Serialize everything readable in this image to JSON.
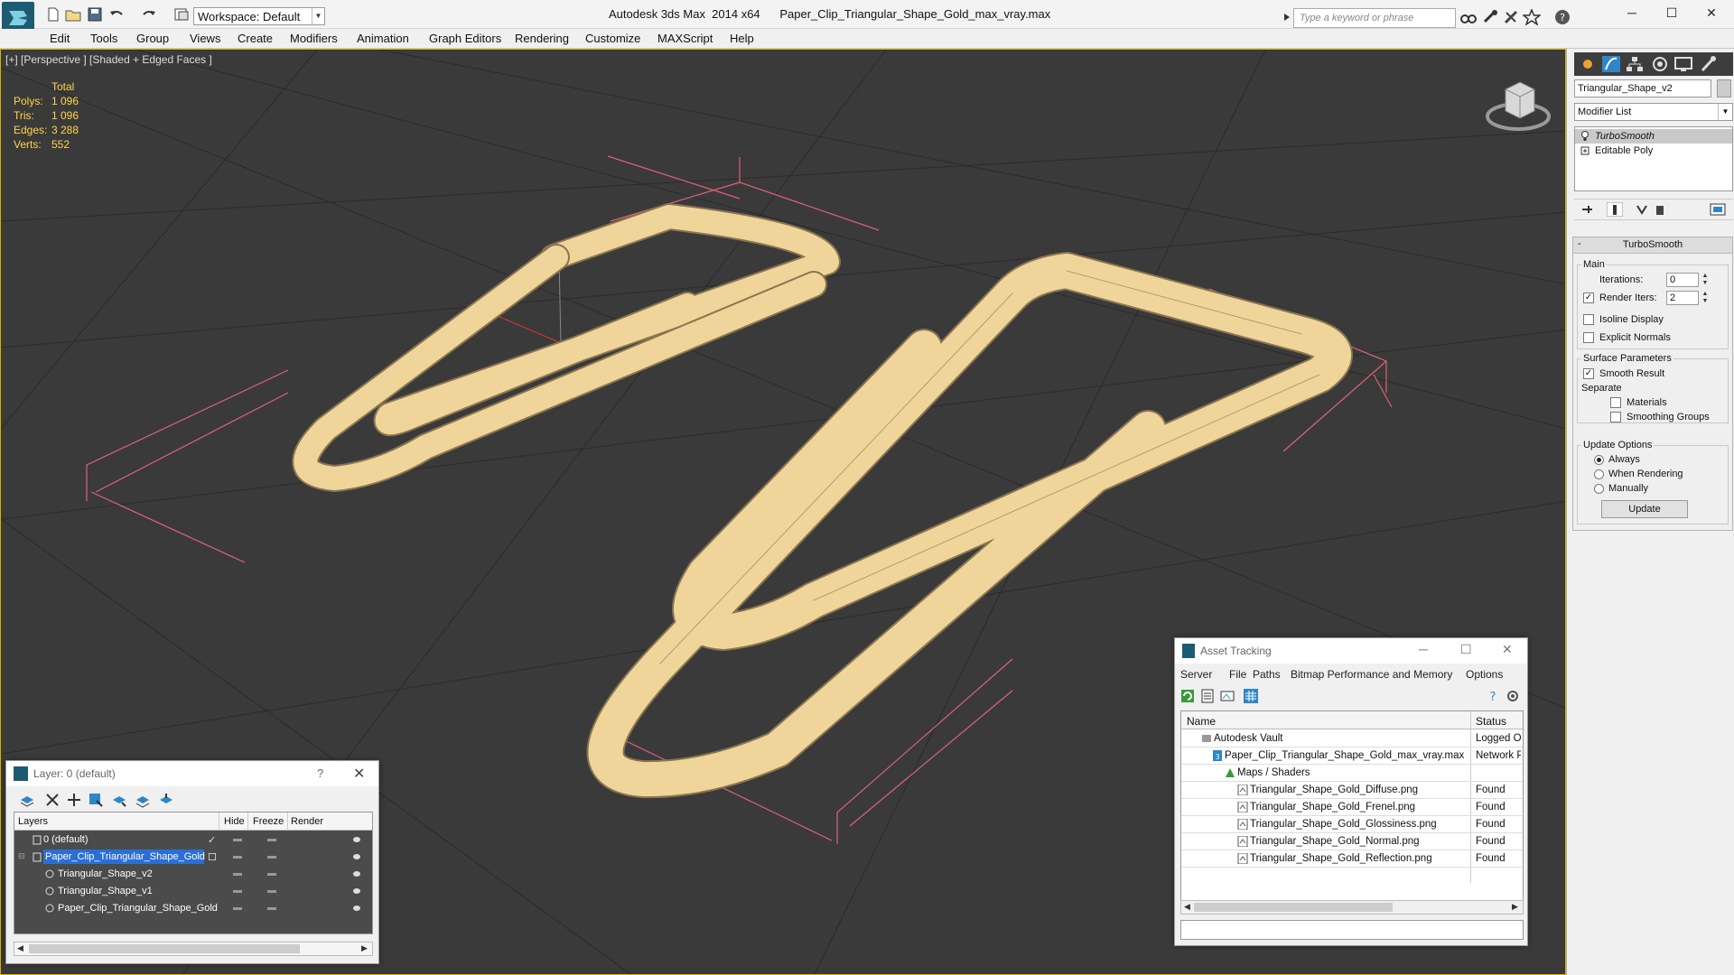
{
  "app": {
    "title": "Autodesk 3ds Max  2014 x64      Paper_Clip_Triangular_Shape_Gold_max_vray.max",
    "workspace": "Workspace: Default",
    "search_placeholder": "Type a keyword or phrase"
  },
  "menu": [
    "Edit",
    "Tools",
    "Group",
    "Views",
    "Create",
    "Modifiers",
    "Animation",
    "Graph Editors",
    "Rendering",
    "Customize",
    "MAXScript",
    "Help"
  ],
  "viewport": {
    "label": "[+] [Perspective ] [Shaded + Edged Faces ]",
    "stats": {
      "header": "Total",
      "rows": [
        {
          "label": "Polys:",
          "value": "1 096"
        },
        {
          "label": "Tris:",
          "value": "1 096"
        },
        {
          "label": "Edges:",
          "value": "3 288"
        },
        {
          "label": "Verts:",
          "value": "552"
        }
      ]
    },
    "colors": {
      "background": "#3a3a3a",
      "clip": "#f0d59a",
      "clip_edge": "#8a7550",
      "stats_text": "#ffd44a",
      "selection_bracket": "#e0607a"
    }
  },
  "command_panel": {
    "object_name": "Triangular_Shape_v2",
    "modifier_list": "Modifier List",
    "stack": [
      "TurboSmooth",
      "Editable Poly"
    ],
    "turbosmooth": {
      "title": "TurboSmooth",
      "main_label": "Main",
      "iterations_label": "Iterations:",
      "iterations": "0",
      "render_iters_label": "Render Iters:",
      "render_iters": "2",
      "isoline_label": "Isoline Display",
      "explicit_normals_label": "Explicit Normals",
      "surface_label": "Surface Parameters",
      "smooth_result_label": "Smooth Result",
      "separate_label": "Separate",
      "materials_label": "Materials",
      "smoothing_groups_label": "Smoothing Groups",
      "update_options_label": "Update Options",
      "always_label": "Always",
      "when_rendering_label": "When Rendering",
      "manually_label": "Manually",
      "update_button": "Update"
    }
  },
  "layer_dialog": {
    "title": "Layer: 0 (default)",
    "help": "?",
    "columns": {
      "layers": "Layers",
      "hide": "Hide",
      "freeze": "Freeze",
      "render": "Render"
    },
    "rows": [
      {
        "name": "0 (default)"
      },
      {
        "name": "Paper_Clip_Triangular_Shape_Gold"
      },
      {
        "name": "Triangular_Shape_v2"
      },
      {
        "name": "Triangular_Shape_v1"
      },
      {
        "name": "Paper_Clip_Triangular_Shape_Gold"
      }
    ]
  },
  "asset_dialog": {
    "title": "Asset Tracking",
    "menu": [
      "Server",
      "File",
      "Paths",
      "Bitmap Performance and Memory",
      "Options"
    ],
    "columns": {
      "name": "Name",
      "status": "Status"
    },
    "rows": [
      {
        "name": "Autodesk Vault",
        "status": "Logged Out"
      },
      {
        "name": "Paper_Clip_Triangular_Shape_Gold_max_vray.max",
        "status": "Network Path"
      },
      {
        "name": "Maps / Shaders",
        "status": ""
      },
      {
        "name": "Triangular_Shape_Gold_Diffuse.png",
        "status": "Found"
      },
      {
        "name": "Triangular_Shape_Gold_Frenel.png",
        "status": "Found"
      },
      {
        "name": "Triangular_Shape_Gold_Glossiness.png",
        "status": "Found"
      },
      {
        "name": "Triangular_Shape_Gold_Normal.png",
        "status": "Found"
      },
      {
        "name": "Triangular_Shape_Gold_Reflection.png",
        "status": "Found"
      }
    ]
  }
}
